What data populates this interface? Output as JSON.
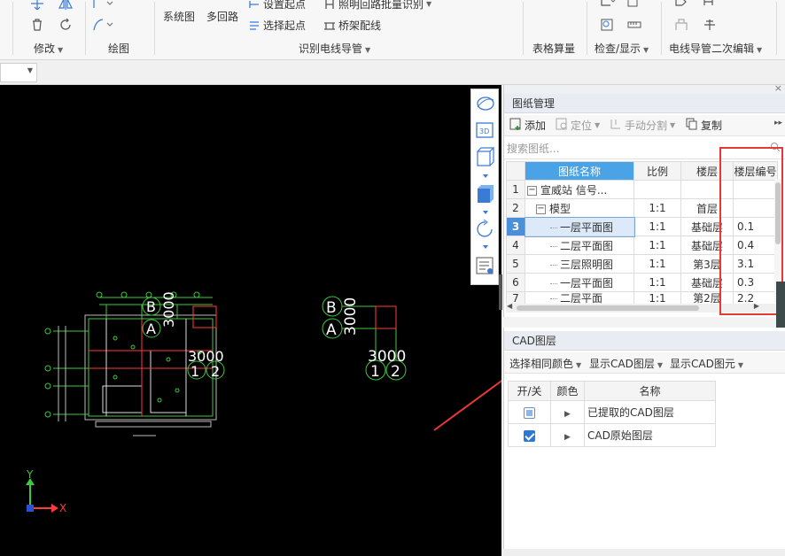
{
  "ribbon": {
    "groups": {
      "modify": "修改",
      "draw": "绘图",
      "identify": "识别电线导管",
      "table_calc": "表格算量",
      "check": "检查/显示",
      "secondary_edit": "电线导管二次编辑"
    },
    "buttons": {
      "system_diagram": "系统图",
      "multi_loop": "多回路",
      "set_start": "设置起点",
      "select_start": "选择起点",
      "lighting_batch": "照明回路批量识别",
      "bridge_wiring": "桥架配线"
    }
  },
  "drawing_panel": {
    "title": "图纸管理",
    "toolbar": {
      "add": "添加",
      "locate": "定位",
      "manual_split": "手动分割",
      "copy": "复制"
    },
    "search_placeholder": "搜索图纸...",
    "columns": [
      "图纸名称",
      "比例",
      "楼层",
      "楼层编号"
    ],
    "rows": [
      {
        "num": "1",
        "name": "宣威站   信号...",
        "scale": "",
        "floor": "",
        "code": ""
      },
      {
        "num": "2",
        "name": "模型",
        "scale": "1:1",
        "floor": "首层",
        "code": ""
      },
      {
        "num": "3",
        "name": "一层平面图",
        "scale": "1:1",
        "floor": "基础层",
        "code": "0.1"
      },
      {
        "num": "4",
        "name": "二层平面图",
        "scale": "1:1",
        "floor": "基础层",
        "code": "0.4"
      },
      {
        "num": "5",
        "name": "三层照明图",
        "scale": "1:1",
        "floor": "第3层",
        "code": "3.1"
      },
      {
        "num": "6",
        "name": "一层平面图",
        "scale": "1:1",
        "floor": "基础层",
        "code": "0.3"
      },
      {
        "num": "7",
        "name": "二层平面",
        "scale": "1:1",
        "floor": "第2层",
        "code": "2.2"
      }
    ]
  },
  "cad_panel": {
    "title": "CAD图层",
    "actions": {
      "select_same_color": "选择相同颜色",
      "show_cad_layer": "显示CAD图层",
      "show_cad_element": "显示CAD图元"
    },
    "columns": [
      "开/关",
      "颜色",
      "名称"
    ],
    "rows": [
      {
        "name": "已提取的CAD图层",
        "state": "partial"
      },
      {
        "name": "CAD原始图层",
        "state": "checked"
      }
    ]
  },
  "canvas": {
    "axis_labels": {
      "B": "B",
      "A": "A",
      "dim": "3000",
      "one": "1",
      "two": "2"
    },
    "ucs": {
      "x": "X",
      "y": "Y"
    }
  },
  "colors": {
    "accent_blue": "#4aa3e6",
    "selected_blue": "#4a8fd8",
    "highlight_red": "#e53935",
    "cad_green": "#3ec83e",
    "cad_red": "#ff3b3b"
  }
}
